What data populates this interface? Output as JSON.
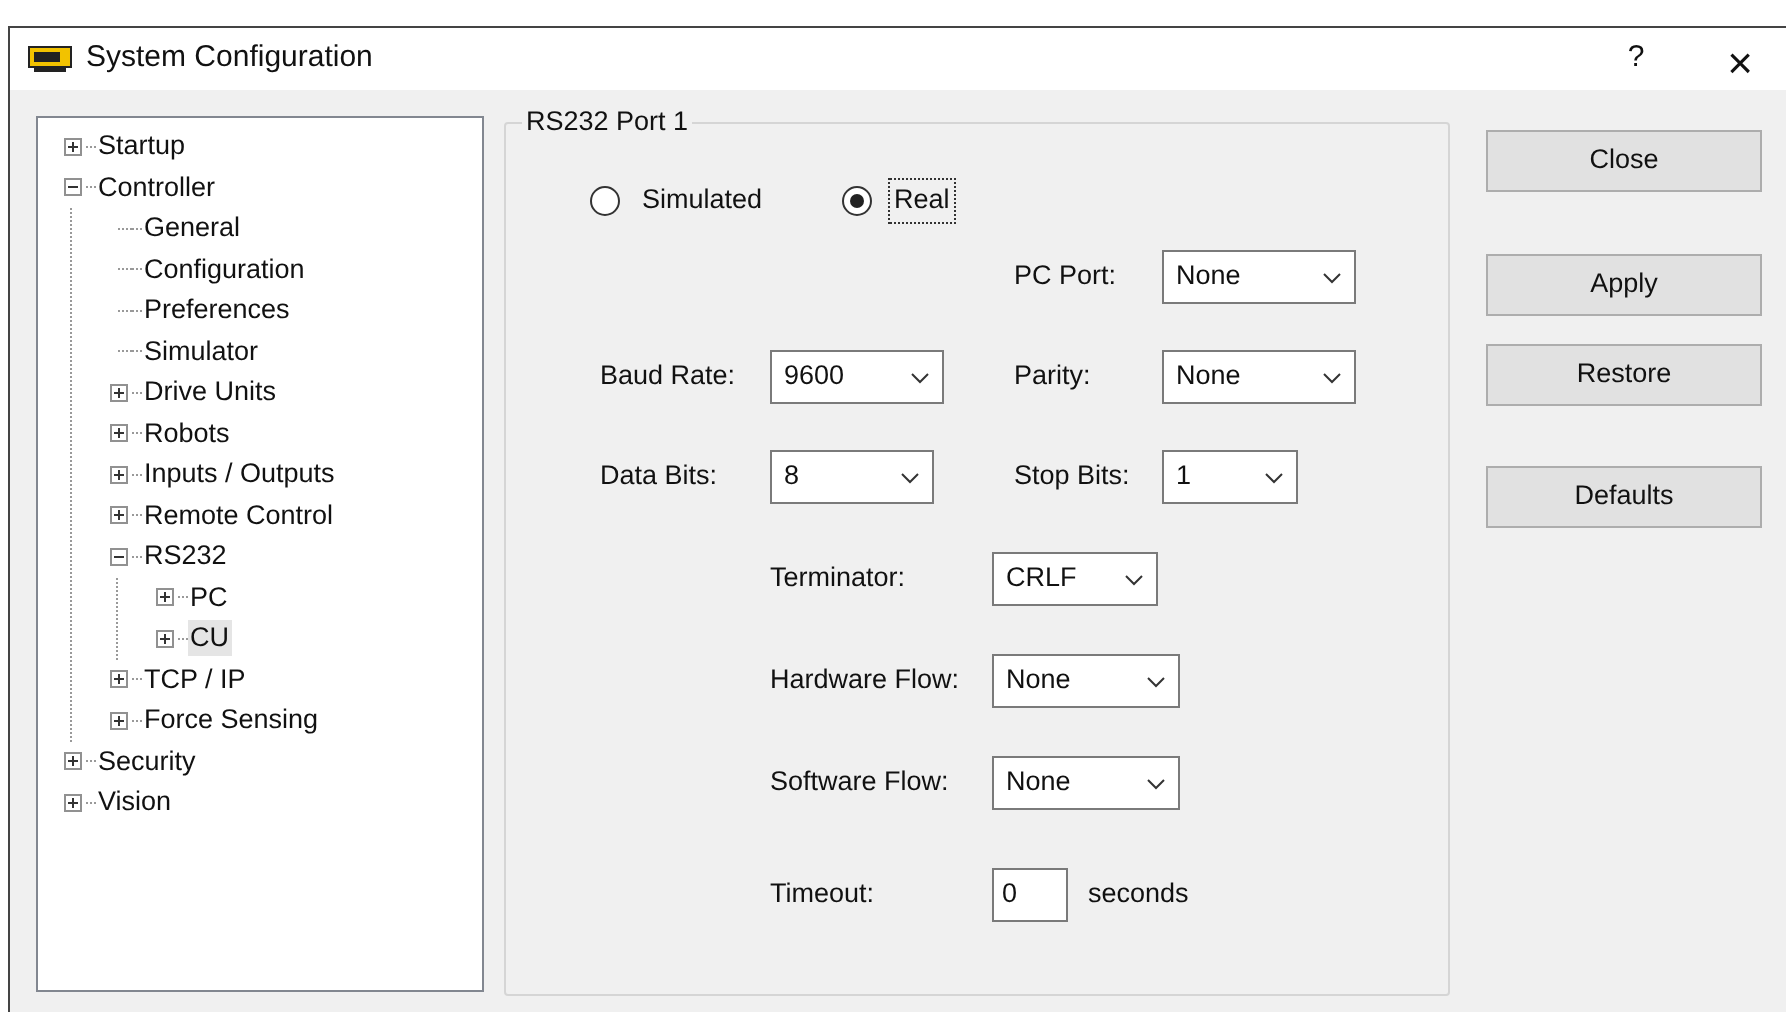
{
  "window": {
    "title": "System Configuration",
    "help": "?",
    "close": "×"
  },
  "tree": [
    {
      "label": "Startup",
      "kind": "folder",
      "expanded": false,
      "selected": false
    },
    {
      "label": "Controller",
      "kind": "folder",
      "expanded": true,
      "selected": false,
      "children": [
        {
          "label": "General",
          "kind": "leaf",
          "selected": false
        },
        {
          "label": "Configuration",
          "kind": "leaf",
          "selected": false
        },
        {
          "label": "Preferences",
          "kind": "leaf",
          "selected": false
        },
        {
          "label": "Simulator",
          "kind": "leaf",
          "selected": false
        },
        {
          "label": "Drive Units",
          "kind": "folder",
          "expanded": false,
          "selected": false
        },
        {
          "label": "Robots",
          "kind": "folder",
          "expanded": false,
          "selected": false
        },
        {
          "label": "Inputs / Outputs",
          "kind": "folder",
          "expanded": false,
          "selected": false
        },
        {
          "label": "Remote Control",
          "kind": "folder",
          "expanded": false,
          "selected": false
        },
        {
          "label": "RS232",
          "kind": "folder",
          "expanded": true,
          "selected": false,
          "children": [
            {
              "label": "PC",
              "kind": "folder",
              "expanded": false,
              "selected": false
            },
            {
              "label": "CU",
              "kind": "folder",
              "expanded": false,
              "selected": true
            }
          ]
        },
        {
          "label": "TCP / IP",
          "kind": "folder",
          "expanded": false,
          "selected": false
        },
        {
          "label": "Force Sensing",
          "kind": "folder",
          "expanded": false,
          "selected": false
        }
      ]
    },
    {
      "label": "Security",
      "kind": "folder",
      "expanded": false,
      "selected": false
    },
    {
      "label": "Vision",
      "kind": "folder",
      "expanded": false,
      "selected": false
    }
  ],
  "group": {
    "title": "RS232 Port 1",
    "mode": [
      {
        "label": "Simulated",
        "selected": false
      },
      {
        "label": "Real",
        "selected": true
      }
    ],
    "pc_port": {
      "label": "PC Port:",
      "value": "None"
    },
    "baud_rate": {
      "label": "Baud Rate:",
      "value": "9600"
    },
    "parity": {
      "label": "Parity:",
      "value": "None"
    },
    "data_bits": {
      "label": "Data Bits:",
      "value": "8"
    },
    "stop_bits": {
      "label": "Stop Bits:",
      "value": "1"
    },
    "terminator": {
      "label": "Terminator:",
      "value": "CRLF"
    },
    "hardware_flow": {
      "label": "Hardware Flow:",
      "value": "None"
    },
    "software_flow": {
      "label": "Software Flow:",
      "value": "None"
    },
    "timeout": {
      "label": "Timeout:",
      "value": "0",
      "unit": "seconds"
    }
  },
  "buttons": [
    "Close",
    "Apply",
    "Restore",
    "Defaults"
  ]
}
